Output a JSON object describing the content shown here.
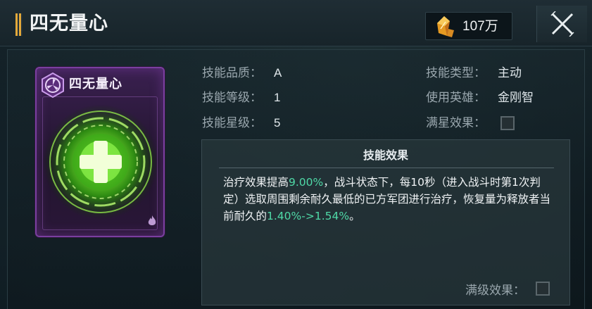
{
  "window": {
    "title": "四无量心",
    "currency_amount": "107万",
    "icons": {
      "currency": "orange-crystal-icon",
      "close": "close-x-icon"
    }
  },
  "card": {
    "name": "四无量心",
    "badge_icon": "purple-hexagon-badge-icon",
    "art_icon": "green-cross-heal-icon"
  },
  "info": {
    "quality_label": "技能品质：",
    "quality_value": "A",
    "level_label": "技能等级：",
    "level_value": "1",
    "star_label": "技能星级：",
    "star_value": "5",
    "type_label": "技能类型：",
    "type_value": "主动",
    "hero_label": "使用英雄：",
    "hero_value": "金刚智",
    "full_star_label": "满星效果：",
    "full_star_checked": false
  },
  "effect": {
    "title": "技能效果",
    "parts": [
      {
        "text": "治疗效果提高",
        "highlight": false
      },
      {
        "text": "9.00%",
        "highlight": true
      },
      {
        "text": "，战斗状态下，每10秒（进入战斗时第1次判定）选取周围剩余耐久最低的已方军团进行治疗，恢复量为释放者当前耐久的",
        "highlight": false
      },
      {
        "text": "1.40%->1.54%",
        "highlight": true
      },
      {
        "text": "。",
        "highlight": false
      }
    ],
    "max_level_label": "满级效果：",
    "max_level_checked": false
  },
  "colors": {
    "highlight": "#4fd9a7",
    "card_border": "#7a3fa0",
    "accent_gold": "#e3a93a"
  }
}
